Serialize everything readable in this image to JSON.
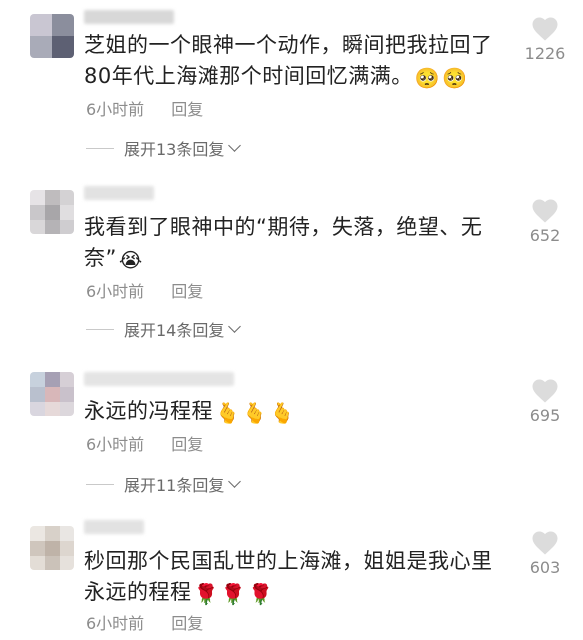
{
  "comments": [
    {
      "text": "芝姐的一个眼神一个动作，瞬间把我拉回了80年代上海滩那个时间回忆满满。",
      "emojis": [
        "🥺",
        "🥺"
      ],
      "time": "6小时前",
      "reply_label": "回复",
      "expand_label": "展开13条回复",
      "likes": "1226"
    },
    {
      "text": "我看到了眼神中的“期待，失落，绝望、无奈”",
      "emojis": [
        "😭"
      ],
      "time": "6小时前",
      "reply_label": "回复",
      "expand_label": "展开14条回复",
      "likes": "652"
    },
    {
      "text": "永远的冯程程",
      "emojis": [
        "🫰",
        "🫰",
        "🫰"
      ],
      "time": "6小时前",
      "reply_label": "回复",
      "expand_label": "展开11条回复",
      "likes": "695"
    },
    {
      "text": "秒回那个民国乱世的上海滩，姐姐是我心里永远的程程",
      "emojis": [
        "🌹",
        "🌹",
        "🌹"
      ],
      "time": "6小时前",
      "reply_label": "回复",
      "likes": "603"
    }
  ],
  "colors": {
    "text": "#222222",
    "meta": "#8c8c8c",
    "expand": "#6a6a6a",
    "heart": "#d6d6d6"
  },
  "icons": {
    "like": "heart-outline-icon",
    "expand": "chevron-down-icon"
  }
}
